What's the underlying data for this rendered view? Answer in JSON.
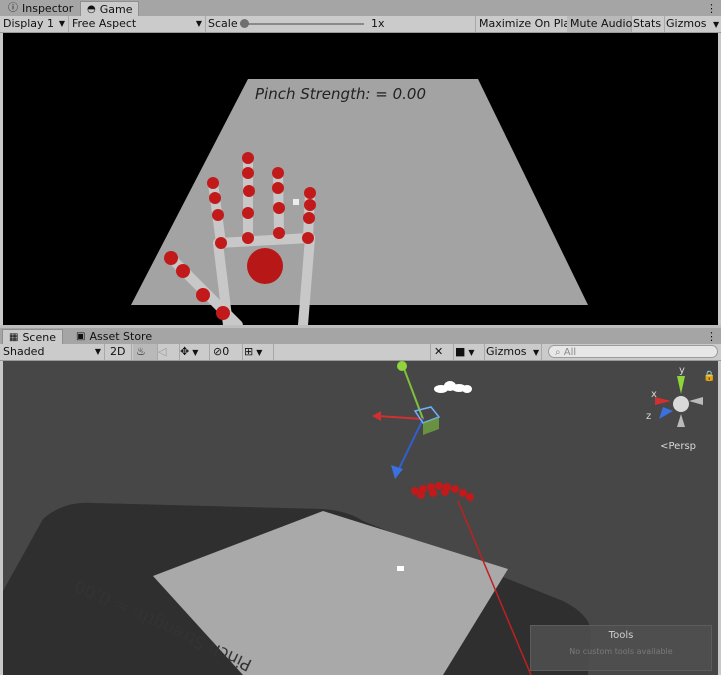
{
  "top_tabs": {
    "inspector": "Inspector",
    "game": "Game"
  },
  "game_toolbar": {
    "display": "Display 1",
    "aspect": "Free Aspect",
    "scale_label": "Scale",
    "scale_value": "1x",
    "maximize": "Maximize On Play",
    "mute": "Mute Audio",
    "stats": "Stats",
    "gizmos": "Gizmos"
  },
  "game_view": {
    "pinch_text": "Pinch Strength: = 0.00"
  },
  "scene_tabs": {
    "scene": "Scene",
    "asset_store": "Asset Store"
  },
  "scene_toolbar": {
    "shading": "Shaded",
    "mode_2d": "2D",
    "hidden_count": "0",
    "gizmos": "Gizmos",
    "search_placeholder": "All"
  },
  "scene_view": {
    "pinch_text": "Pinch Strength: = 0.00",
    "persp": "Persp",
    "gizmo_y": "y",
    "gizmo_x": "x",
    "gizmo_z": "z",
    "tools_title": "Tools",
    "tools_subtitle": "No custom tools available"
  },
  "colors": {
    "editor_bg": "#c8c8c8",
    "scene_bg": "#474747",
    "plane": "#9e9e9e",
    "joint_red": "#c21a1a"
  }
}
